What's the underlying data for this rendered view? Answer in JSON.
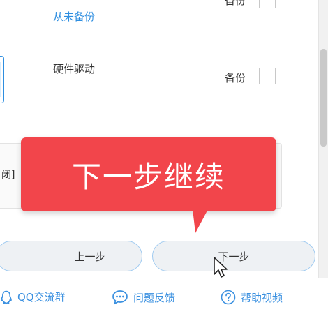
{
  "list": {
    "row_top": {
      "label_partial": "备份",
      "status": "从未备份"
    },
    "row_driver": {
      "name": "硬件驱动",
      "backup_label": "备份"
    }
  },
  "panel": {
    "partial_text": "闭]"
  },
  "tooltip": {
    "text": "下一步继续"
  },
  "buttons": {
    "prev_label": "上一步",
    "next_label": "下一步"
  },
  "footer": {
    "qq_group": "QQ交流群",
    "feedback": "问题反馈",
    "help_video": "帮助视频"
  },
  "colors": {
    "accent": "#2e8ee0",
    "tooltip_bg": "#f2454b"
  },
  "icons": {
    "qq": "qq-penguin-icon",
    "feedback": "speech-bubble-icon",
    "help": "question-circle-icon"
  }
}
